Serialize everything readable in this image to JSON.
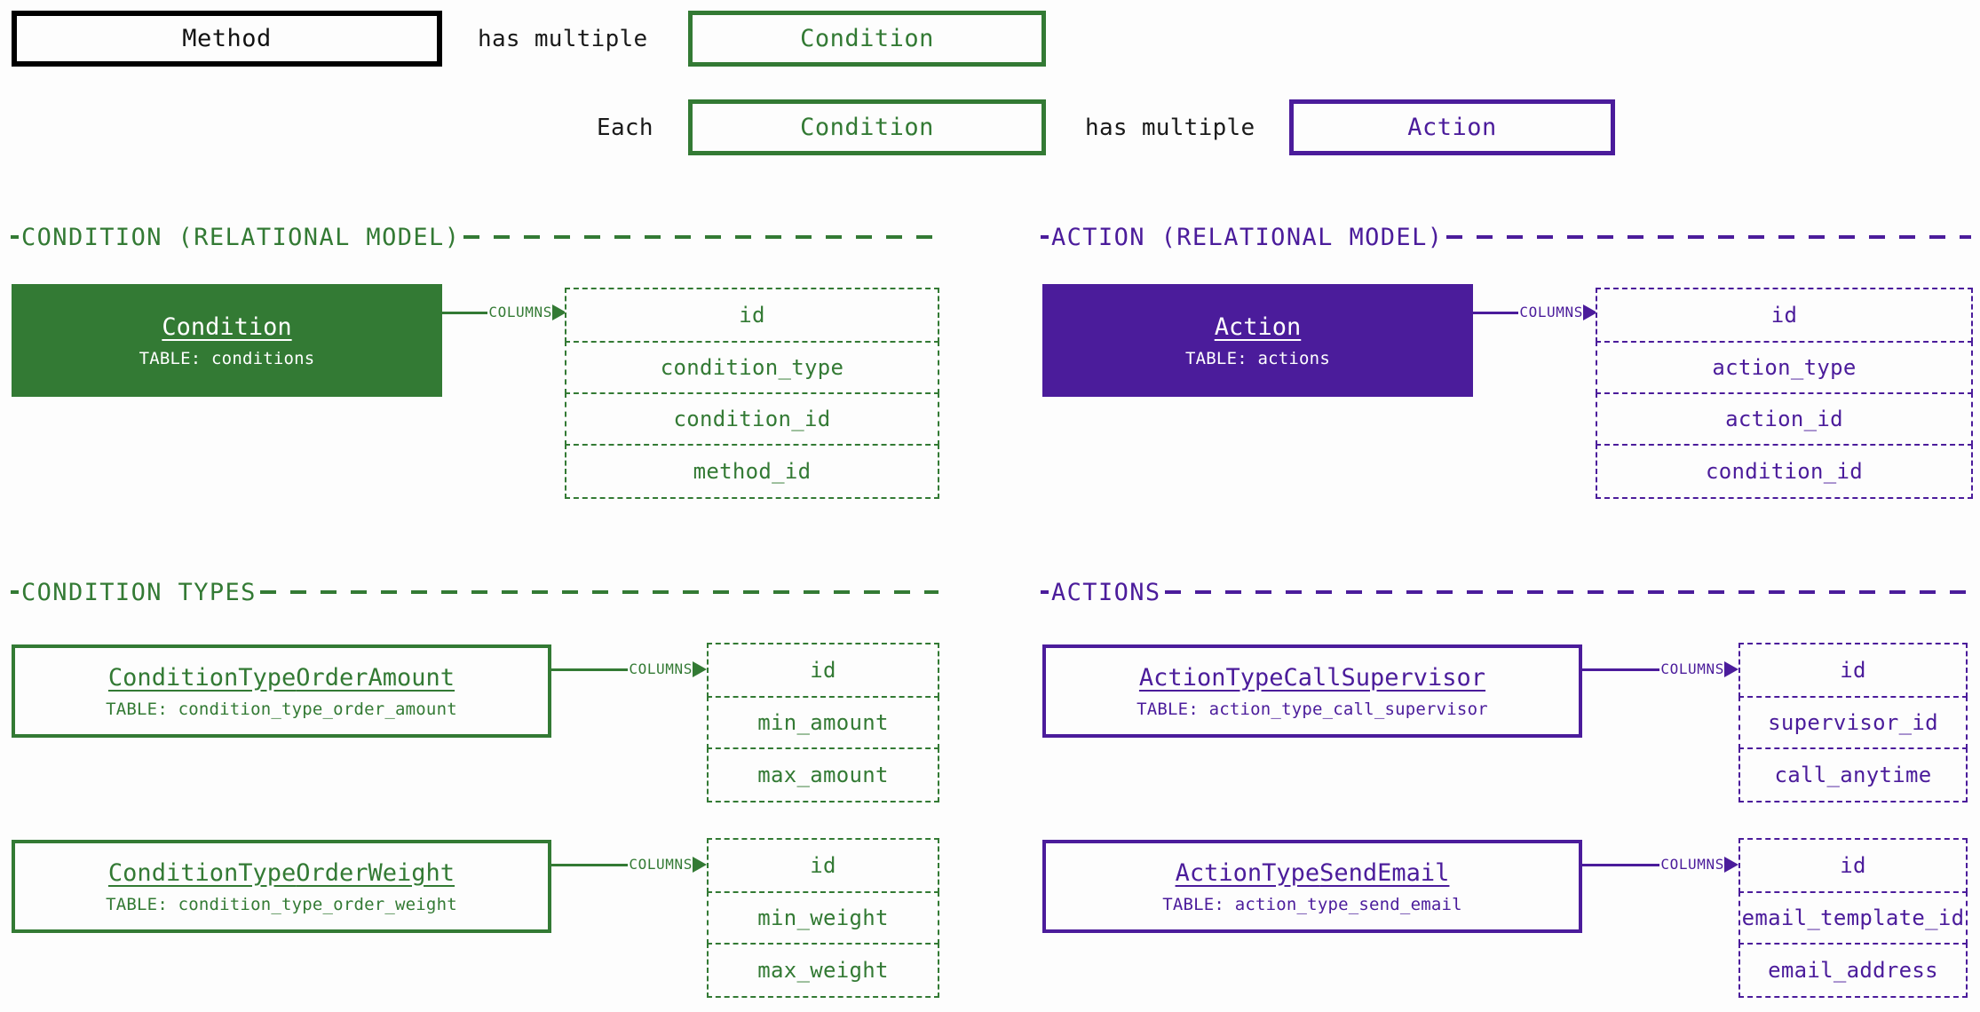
{
  "colors": {
    "green": "#337a34",
    "purple": "#4b1c9b",
    "black": "#000000",
    "background": "#fdfdfd"
  },
  "relationships": {
    "row1": {
      "subject": "Method",
      "predicate": "has multiple",
      "object": "Condition"
    },
    "row2": {
      "prefix": "Each",
      "subject": "Condition",
      "predicate": "has multiple",
      "object": "Action"
    }
  },
  "connector_label": "COLUMNS",
  "sections": [
    {
      "id": "condition-relational-model",
      "title": "CONDITION (RELATIONAL MODEL)",
      "color": "green",
      "entities": [
        {
          "name_underlined": "Condition",
          "name_plain": "",
          "table_label": "TABLE: conditions",
          "style": "filled-green",
          "columns": [
            "id",
            "condition_type",
            "condition_id",
            "method_id"
          ]
        }
      ]
    },
    {
      "id": "action-relational-model",
      "title": "ACTION (RELATIONAL MODEL)",
      "color": "purple",
      "entities": [
        {
          "name_underlined": "Action",
          "name_plain": "",
          "table_label": "TABLE: actions",
          "style": "filled-purple",
          "columns": [
            "id",
            "action_type",
            "action_id",
            "condition_id"
          ]
        }
      ]
    },
    {
      "id": "condition-types",
      "title": "CONDITION TYPES",
      "color": "green",
      "entities": [
        {
          "name_underlined": "ConditionType",
          "name_plain": "OrderAmount",
          "table_label": "TABLE: condition_type_order_amount",
          "style": "outline-green",
          "columns": [
            "id",
            "min_amount",
            "max_amount"
          ]
        },
        {
          "name_underlined": "ConditionType",
          "name_plain": "OrderWeight",
          "table_label": "TABLE: condition_type_order_weight",
          "style": "outline-green",
          "columns": [
            "id",
            "min_weight",
            "max_weight"
          ]
        }
      ]
    },
    {
      "id": "actions",
      "title": "ACTIONS",
      "color": "purple",
      "entities": [
        {
          "name_underlined": "ActionType",
          "name_plain": "CallSupervisor",
          "table_label": "TABLE: action_type_call_supervisor",
          "style": "outline-purple",
          "columns": [
            "id",
            "supervisor_id",
            "call_anytime"
          ]
        },
        {
          "name_underlined": "ActionType",
          "name_plain": "SendEmail",
          "table_label": "TABLE: action_type_send_email",
          "style": "outline-purple",
          "columns": [
            "id",
            "email_template_id",
            "email_address"
          ]
        }
      ]
    }
  ]
}
